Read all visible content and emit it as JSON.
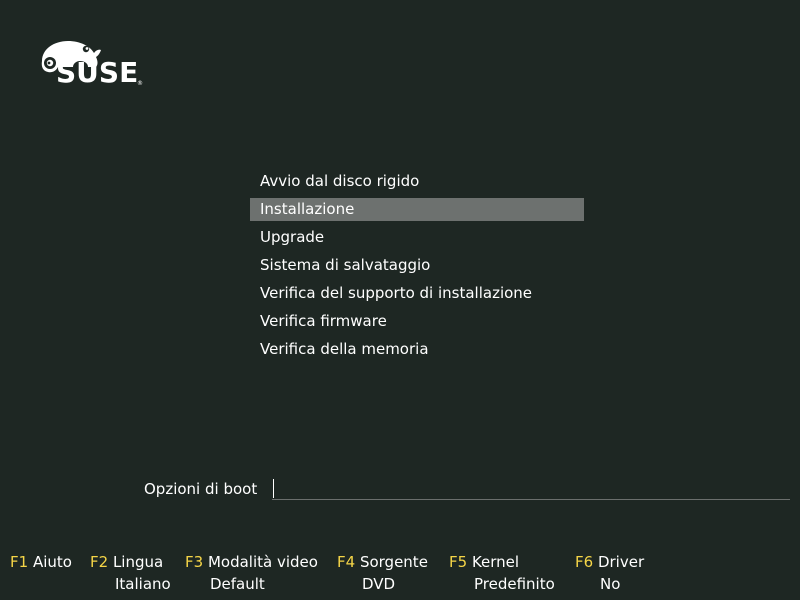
{
  "logo": {
    "text": "SUSE",
    "mark": "®",
    "icon": "chameleon-icon"
  },
  "menu": {
    "items": [
      {
        "label": "Avvio dal disco rigido",
        "selected": false
      },
      {
        "label": "Installazione",
        "selected": true
      },
      {
        "label": "Upgrade",
        "selected": false
      },
      {
        "label": "Sistema di salvataggio",
        "selected": false
      },
      {
        "label": "Verifica del supporto di installazione",
        "selected": false
      },
      {
        "label": "Verifica firmware",
        "selected": false
      },
      {
        "label": "Verifica della memoria",
        "selected": false
      }
    ]
  },
  "boot": {
    "label": "Opzioni di boot",
    "value": ""
  },
  "fkeys": [
    {
      "key": "F1",
      "name": "Aiuto",
      "value": ""
    },
    {
      "key": "F2",
      "name": "Lingua",
      "value": "Italiano"
    },
    {
      "key": "F3",
      "name": "Modalità video",
      "value": "Default"
    },
    {
      "key": "F4",
      "name": "Sorgente",
      "value": "DVD"
    },
    {
      "key": "F5",
      "name": "Kernel",
      "value": "Predefinito"
    },
    {
      "key": "F6",
      "name": "Driver",
      "value": "No"
    }
  ],
  "colors": {
    "background": "#1e2723",
    "selection": "#6d716f",
    "fkey": "#f5d547"
  }
}
